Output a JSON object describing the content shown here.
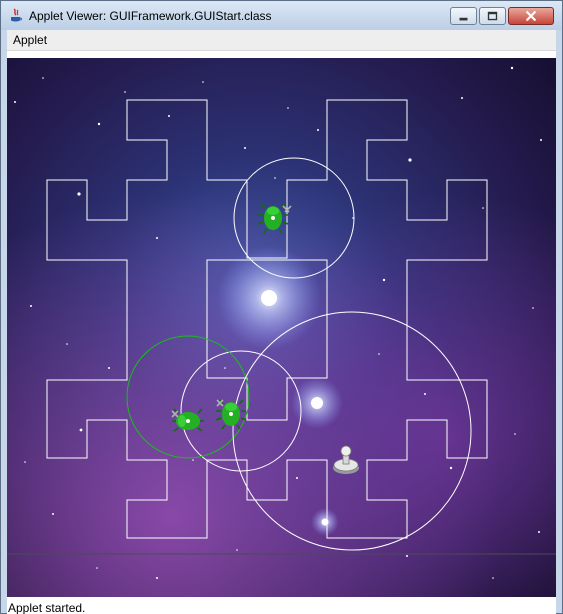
{
  "window": {
    "title": "Applet Viewer: GUIFramework.GUIStart.class",
    "controls": [
      "minimize-icon",
      "maximize-icon",
      "close-icon"
    ]
  },
  "menubar": {
    "items": [
      {
        "label": "Applet"
      }
    ]
  },
  "game": {
    "background": "starfield-nebula",
    "maze_line_color": "#ffffff",
    "enemy_color": "#1f9d1f",
    "enemy_range_color": "#18c018",
    "tower_range_color": "#ffffff",
    "enemies": 3,
    "towers": 1
  },
  "status_bar": {
    "text": "Applet started."
  }
}
